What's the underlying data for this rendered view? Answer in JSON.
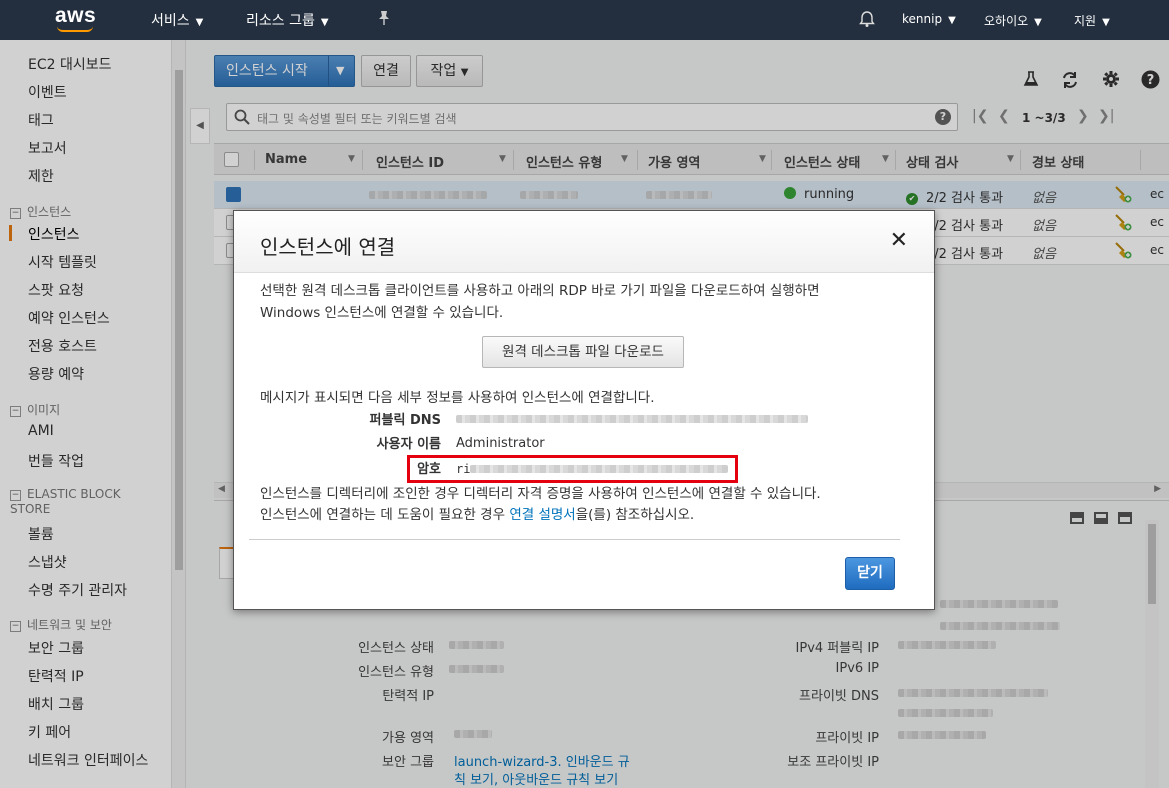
{
  "topnav": {
    "logo": "aws",
    "services": "서비스",
    "resource_groups": "리소스 그룹",
    "user": "kennip",
    "region": "오하이오",
    "support": "지원"
  },
  "sidebar": {
    "items_top": [
      "EC2 대시보드",
      "이벤트",
      "태그",
      "보고서",
      "제한"
    ],
    "group_instances": "인스턴스",
    "items_instances": [
      "인스턴스",
      "시작 템플릿",
      "스팟 요청",
      "예약 인스턴스",
      "전용 호스트",
      "용량 예약"
    ],
    "group_images": "이미지",
    "items_images": [
      "AMI",
      "번들 작업"
    ],
    "group_ebs": "ELASTIC BLOCK STORE",
    "items_ebs": [
      "볼륨",
      "스냅샷",
      "수명 주기 관리자"
    ],
    "group_network": "네트워크 및 보안",
    "items_network": [
      "보안 그룹",
      "탄력적 IP",
      "배치 그룹",
      "키 페어",
      "네트워크 인터페이스"
    ]
  },
  "toolbar": {
    "launch": "인스턴스 시작",
    "connect": "연결",
    "actions": "작업"
  },
  "filter": {
    "placeholder": "태그 및 속성별 필터 또는 키워드별 검색",
    "pager": "1 ~3/3"
  },
  "table": {
    "headers": [
      "Name",
      "인스턴스 ID",
      "인스턴스 유형",
      "가용 영역",
      "인스턴스 상태",
      "상태 검사",
      "경보 상태"
    ],
    "rows": [
      {
        "state": "running",
        "checks": "2/2 검사 통과",
        "alarm": "없음",
        "extra": "ec"
      },
      {
        "checks": "2/2 검사 통과",
        "alarm": "없음",
        "extra": "ec"
      },
      {
        "checks": "2/2 검사 통과",
        "alarm": "없음",
        "extra": "ec"
      }
    ]
  },
  "details": {
    "left_labels": [
      "인스턴스 상태",
      "인스턴스 유형",
      "탄력적 IP",
      "가용 영역",
      "보안 그룹"
    ],
    "security_group_link": "launch-wizard-3",
    "security_group_rest": ". 인바운드 규",
    "security_group_line2": "칙 보기, 아웃바운드 규칙 보기",
    "right_labels": [
      "IPv4 퍼블릭 IP",
      "IPv6 IP",
      "프라이빗 DNS",
      "프라이빗 IP",
      "보조 프라이빗 IP"
    ]
  },
  "modal": {
    "title": "인스턴스에 연결",
    "intro_line1": "선택한 원격 데스크톱 클라이언트를 사용하고 아래의 RDP 바로 가기 파일을 다운로드하여 실행하면",
    "intro_line2": "Windows 인스턴스에 연결할 수 있습니다.",
    "download_button": "원격 데스크톱 파일 다운로드",
    "details_intro": "메시지가 표시되면 다음 세부 정보를 사용하여 인스턴스에 연결합니다.",
    "label_dns": "퍼블릭 DNS",
    "label_user": "사용자 이름",
    "value_user": "Administrator",
    "label_password": "암호",
    "value_password_prefix": "ri",
    "directory_line": "인스턴스를 디렉터리에 조인한 경우 디렉터리 자격 증명을 사용하여 인스턴스에 연결할 수 있습니다.",
    "help_prefix": "인스턴스에 연결하는 데 도움이 필요한 경우 ",
    "help_link": "연결 설명서",
    "help_suffix": "을(를) 참조하십시오.",
    "close_button": "닫기"
  }
}
